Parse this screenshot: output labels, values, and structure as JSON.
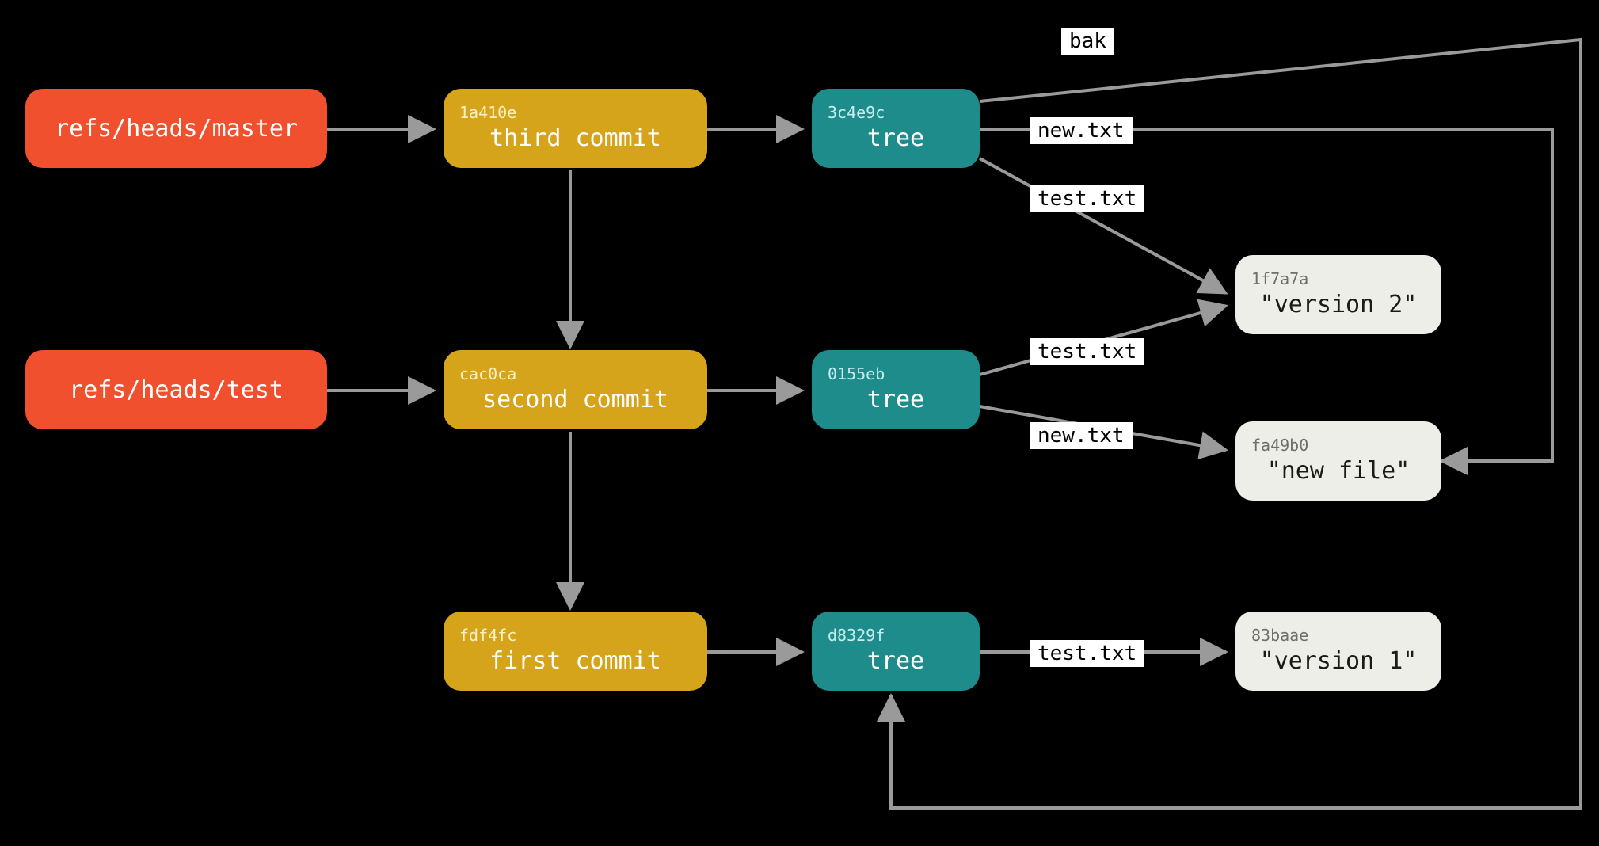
{
  "colors": {
    "ref": "#f0502d",
    "commit": "#d6a41a",
    "tree": "#1f8c8c",
    "blob": "#eeeee8",
    "edge": "#9a9a9a",
    "bg": "#000000"
  },
  "refs": {
    "master": {
      "path": "refs/heads/master"
    },
    "test": {
      "path": "refs/heads/test"
    }
  },
  "commits": {
    "third": {
      "hash": "1a410e",
      "label": "third commit"
    },
    "second": {
      "hash": "cac0ca",
      "label": "second commit"
    },
    "first": {
      "hash": "fdf4fc",
      "label": "first commit"
    }
  },
  "trees": {
    "t3": {
      "hash": "3c4e9c",
      "label": "tree"
    },
    "t2": {
      "hash": "0155eb",
      "label": "tree"
    },
    "t1": {
      "hash": "d8329f",
      "label": "tree"
    }
  },
  "blobs": {
    "v2": {
      "hash": "1f7a7a",
      "label": "\"version 2\""
    },
    "nf": {
      "hash": "fa49b0",
      "label": "\"new file\""
    },
    "v1": {
      "hash": "83baae",
      "label": "\"version 1\""
    }
  },
  "edge_labels": {
    "t3_bak": "bak",
    "t3_new": "new.txt",
    "t3_test": "test.txt",
    "t2_test": "test.txt",
    "t2_new": "new.txt",
    "t1_test": "test.txt"
  }
}
